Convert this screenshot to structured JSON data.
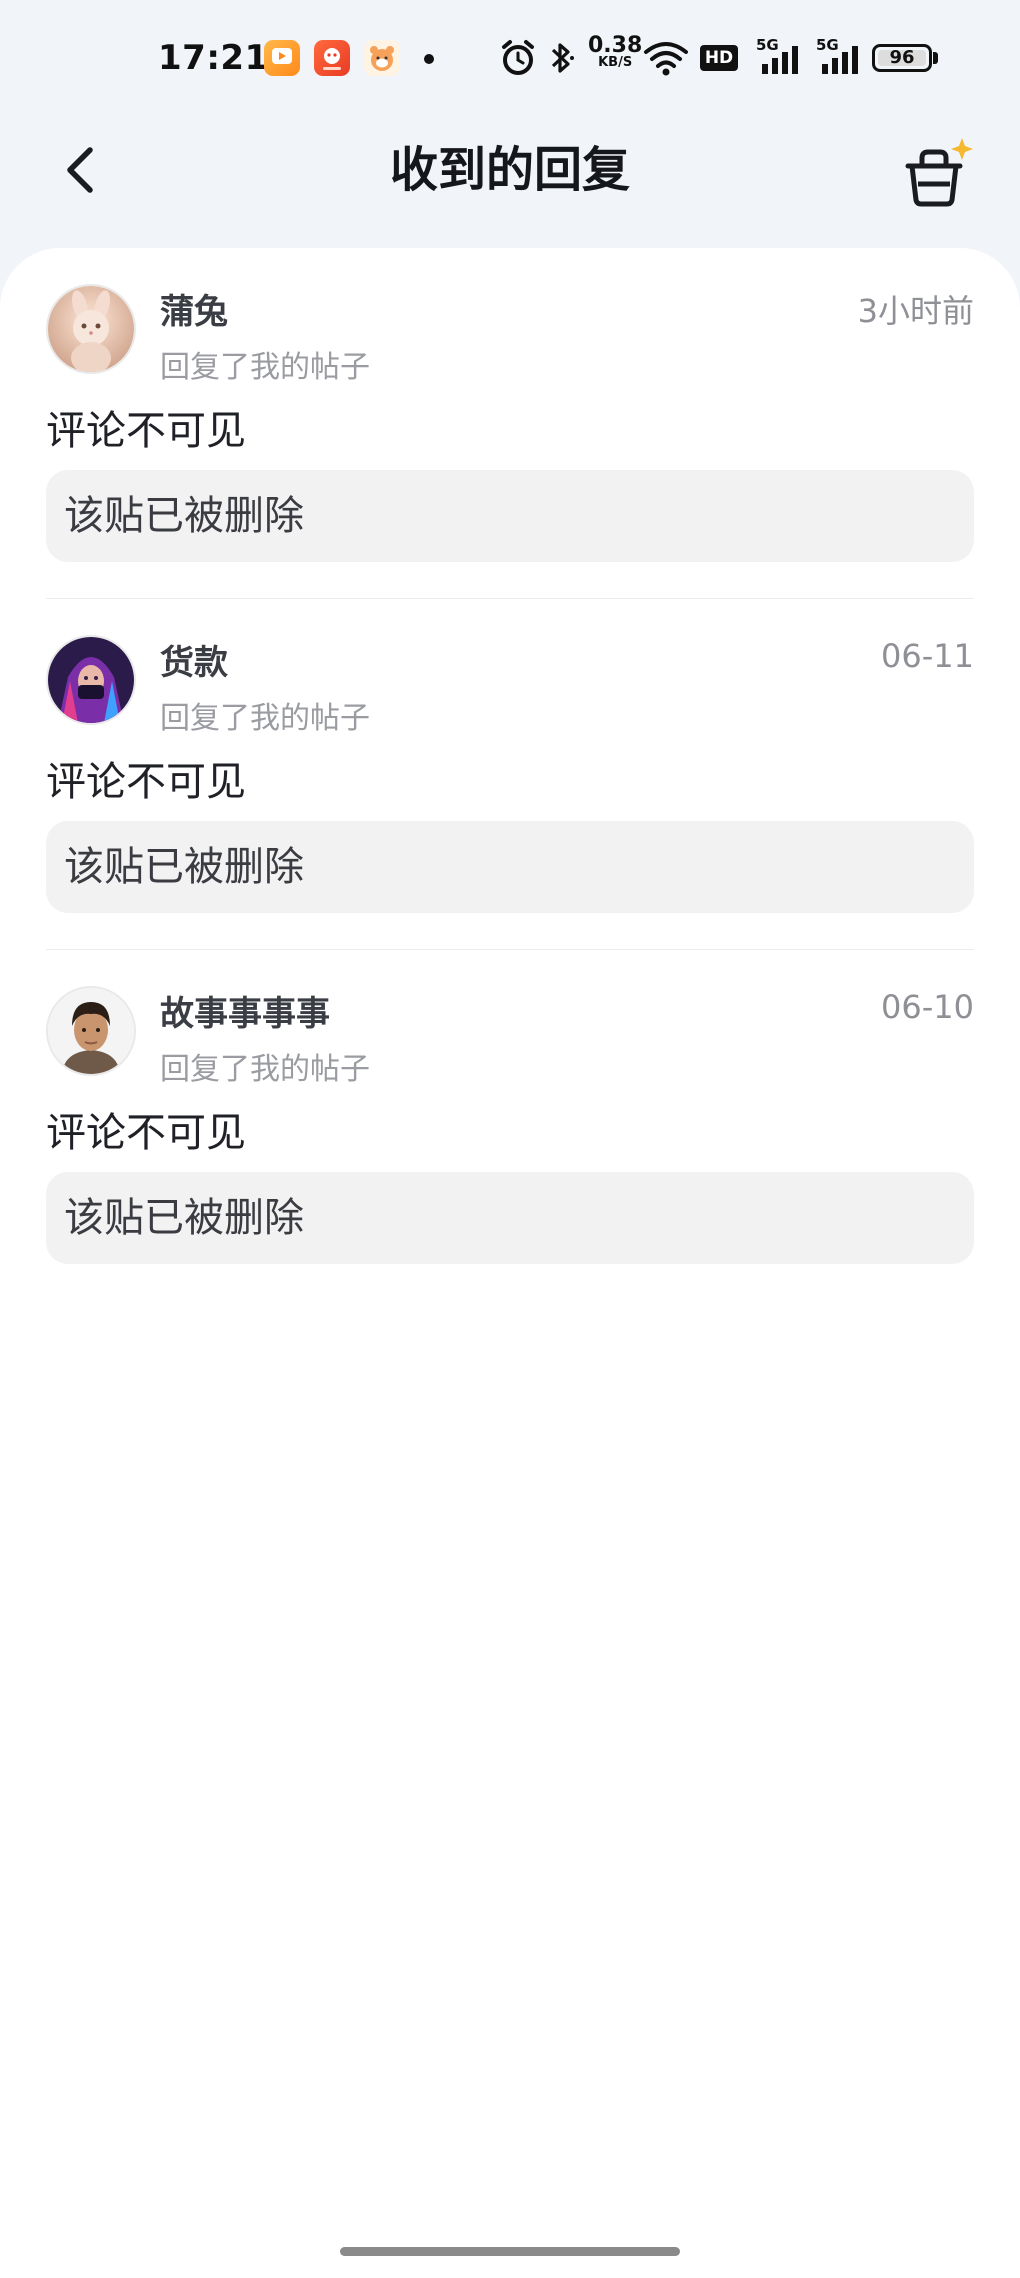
{
  "status_bar": {
    "time": "17:21",
    "net_speed": "0.38",
    "net_speed_unit": "KB/S",
    "hd_label": "HD",
    "signal_1": "5G",
    "signal_2": "5G",
    "battery": "96",
    "icons": [
      "video-app-icon",
      "shop-app-icon",
      "hamster-app-icon",
      "alarm-icon",
      "bluetooth-icon",
      "wifi-icon",
      "hd-icon",
      "signal-icon",
      "battery-icon"
    ]
  },
  "header": {
    "title": "收到的回复",
    "back_icon": "chevron-left-icon",
    "action_icon": "basket-sparkle-icon"
  },
  "replies": [
    {
      "username": "蒲兔",
      "time": "3小时前",
      "subtitle": "回复了我的帖子",
      "comment": "评论不可见",
      "quote": "该贴已被删除",
      "avatar": "bunny-avatar"
    },
    {
      "username": "货款",
      "time": "06-11",
      "subtitle": "回复了我的帖子",
      "comment": "评论不可见",
      "quote": "该贴已被删除",
      "avatar": "cyber-girl-avatar"
    },
    {
      "username": "故事事事事",
      "time": "06-10",
      "subtitle": "回复了我的帖子",
      "comment": "评论不可见",
      "quote": "该贴已被删除",
      "avatar": "man-avatar"
    }
  ],
  "colors": {
    "background": "#f1f4f8",
    "card": "#ffffff",
    "quote_bg": "#f2f2f3",
    "title": "#15171c",
    "muted": "#9a9ca2",
    "accent_sparkle": "#f5b82e"
  }
}
